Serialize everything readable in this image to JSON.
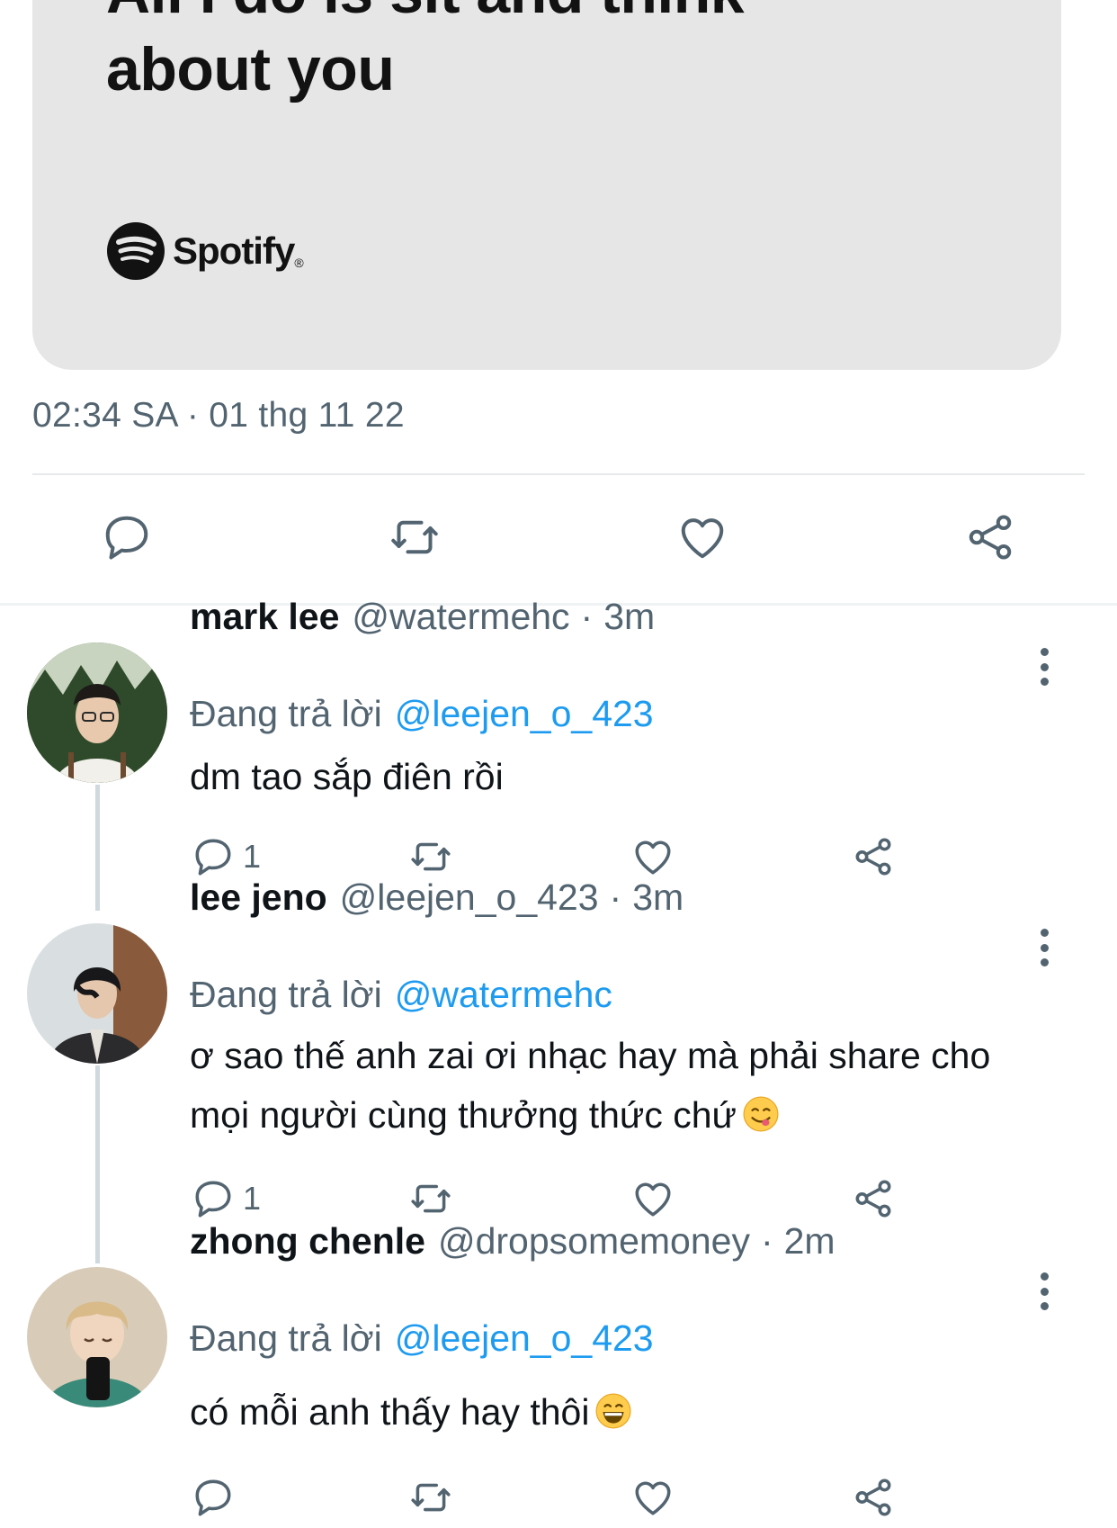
{
  "card": {
    "lyric_line_1": "All I do is sit and think",
    "lyric_line_2": "about you",
    "brand": "Spotify",
    "brand_mark": "®",
    "background": "#e6e6e6"
  },
  "tweet": {
    "timestamp": "02:34 SA · 01 thg 11 22",
    "actions": [
      "reply-icon",
      "retweet-icon",
      "like-icon",
      "share-icon"
    ]
  },
  "replies": [
    {
      "name": "mark lee",
      "handle": "@watermehc",
      "sep": "·",
      "time": "3m",
      "replying_label": "Đang trả lời",
      "mention": "@leejen_o_423",
      "text": "dm tao sắp điên rồi",
      "reply_count": "1"
    },
    {
      "name": "lee jeno",
      "handle": "@leejen_o_423",
      "sep": "·",
      "time": "3m",
      "replying_label": "Đang trả lời",
      "mention": "@watermehc",
      "text_line_1": "ơ sao thế anh zai ơi nhạc hay mà phải share cho",
      "text_line_2": "mọi người cùng thưởng thức chứ",
      "emoji": "face-savoring-food-emoji",
      "reply_count": "1"
    },
    {
      "name": "zhong chenle",
      "handle": "@dropsomemoney",
      "sep": "·",
      "time": "2m",
      "replying_label": "Đang trả lời",
      "mention": "@leejen_o_423",
      "text": "có mỗi anh thấy hay thôi",
      "emoji": "grinning-face-emoji",
      "reply_count": ""
    }
  ],
  "colors": {
    "text": "#0f1419",
    "secondary": "#536471",
    "link": "#1d9bf0",
    "divider": "#e7e9ea",
    "thread_line": "#cfd9de"
  }
}
